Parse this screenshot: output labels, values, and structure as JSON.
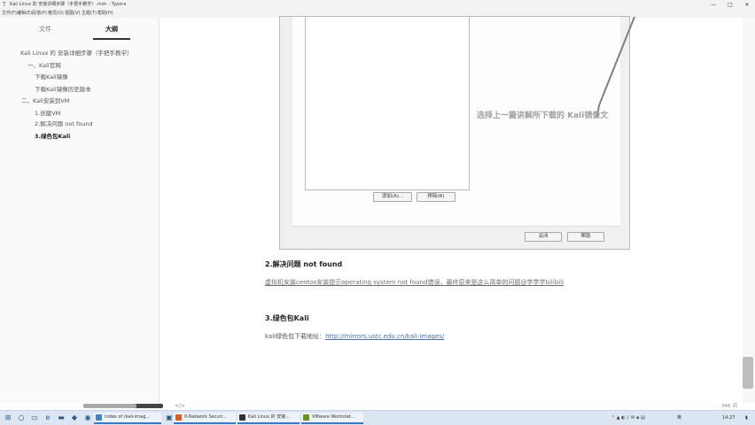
{
  "window": {
    "title": "Kali Linux 的 安装详细步骤（手把手教学）.md• - Typora",
    "controls": [
      "—",
      "□",
      "✕"
    ]
  },
  "menu": [
    "文件(F)",
    "编辑(E)",
    "段落(P)",
    "格式(O)",
    "视图(V)",
    "主题(T)",
    "帮助(H)"
  ],
  "sidebar": {
    "tabs": [
      "文件",
      "大纲"
    ],
    "active_tab": "大纲",
    "outline": [
      {
        "text": "Kali Linux 的 安装详细步骤（手把手教学）",
        "level": 1
      },
      {
        "text": "一、Kali官网",
        "level": 2
      },
      {
        "text": "下载Kali镜像",
        "level": 3
      },
      {
        "text": "下载Kali镜像历史版本",
        "level": 3
      },
      {
        "text": "二、Kali安装到VM",
        "level": 2
      },
      {
        "text": "1.创建VM",
        "level": 3
      },
      {
        "text": "2.解决问题 not found",
        "level": 3
      },
      {
        "text": "3.绿色包Kali",
        "level": 3,
        "bold": true
      }
    ]
  },
  "screenshot": {
    "buttons": [
      "添加(A)...",
      "移除(R)",
      "关闭",
      "帮助"
    ],
    "annotation": "选择上一篇讲解所下载的 Kali镜像文"
  },
  "content": {
    "h2_fix": "2.解决问题 not found",
    "fix_link_text": "虚拟机安装centos安装提示operating system not found错误，最终原来是这么简单的问题@学学学bilibili",
    "h3_green": "3.绿色包Kali",
    "green_prefix": "kali绿色包下载地址：",
    "green_url": "http://mirrors.ustc.edu.cn/kali-images/"
  },
  "statusbar": {
    "source_toggle": "</>",
    "word_count": "346 词"
  },
  "taskbar": {
    "apps": [
      "Index of /kali-imag...",
      "0-Network Securi...",
      "Kali Linux 的 安装...",
      "VMware Workstat..."
    ],
    "clock": "14:27",
    "tray": "英"
  }
}
